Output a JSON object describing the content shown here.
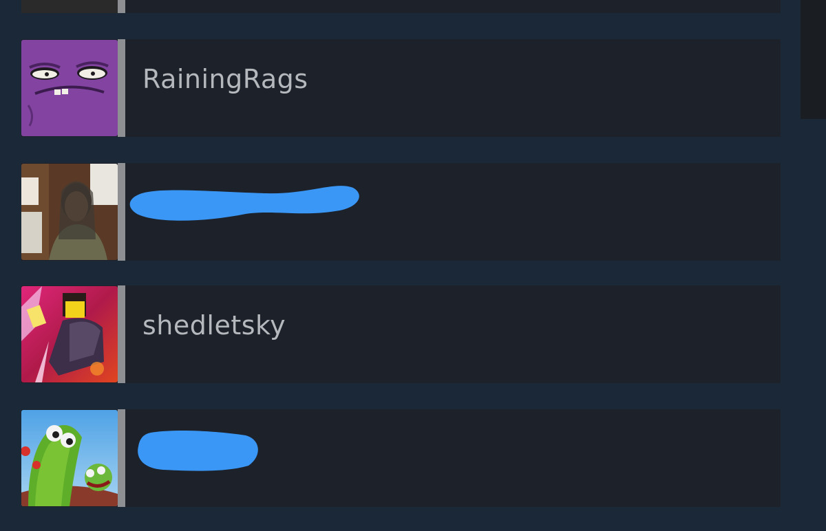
{
  "friends": [
    {
      "name": "RainingRags",
      "avatar": "purple-cartoon-face-avatar",
      "status_color": "#8d8f93",
      "name_redacted": false
    },
    {
      "name": "",
      "avatar": "person-photo-avatar",
      "status_color": "#8d8f93",
      "name_redacted": true
    },
    {
      "name": "shedletsky",
      "avatar": "game-character-avatar",
      "status_color": "#8d8f93",
      "name_redacted": false
    },
    {
      "name": "",
      "avatar": "green-cartoon-creature-avatar",
      "status_color": "#8d8f93",
      "name_redacted": true
    }
  ],
  "colors": {
    "background": "#1b2838",
    "row_background": "#1c212a",
    "name_text": "#b5b8bd",
    "redaction": "#3a97f5",
    "status_offline": "#8d8f93"
  }
}
